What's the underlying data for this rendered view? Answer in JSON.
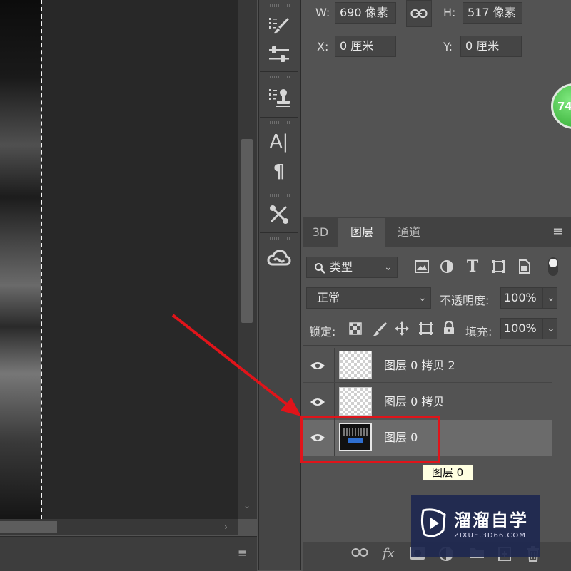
{
  "properties": {
    "w_label": "W:",
    "w_value": "690 像素",
    "h_label": "H:",
    "h_value": "517 像素",
    "x_label": "X:",
    "x_value": "0 厘米",
    "y_label": "Y:",
    "y_value": "0 厘米",
    "badge_text": "74"
  },
  "tabs": [
    "3D",
    "图层",
    "通道"
  ],
  "filter": {
    "kind_label": "类型"
  },
  "blend": {
    "mode": "正常",
    "opacity_label": "不透明度:",
    "opacity_value": "100%"
  },
  "lock": {
    "label": "锁定:",
    "fill_label": "填充:",
    "fill_value": "100%"
  },
  "layers": [
    {
      "name": "图层 0 拷贝 2",
      "selected": false
    },
    {
      "name": "图层 0 拷贝",
      "selected": false
    },
    {
      "name": "图层 0",
      "selected": true
    }
  ],
  "tooltip": "图层 0",
  "footer": {
    "fx_label": "fx"
  },
  "watermark": {
    "title": "溜溜自学",
    "url": "ZIXUE.3D66.COM"
  },
  "colors": {
    "highlight": "#e0141a",
    "panel": "#535353",
    "selected_row": "#6b6b6b"
  }
}
